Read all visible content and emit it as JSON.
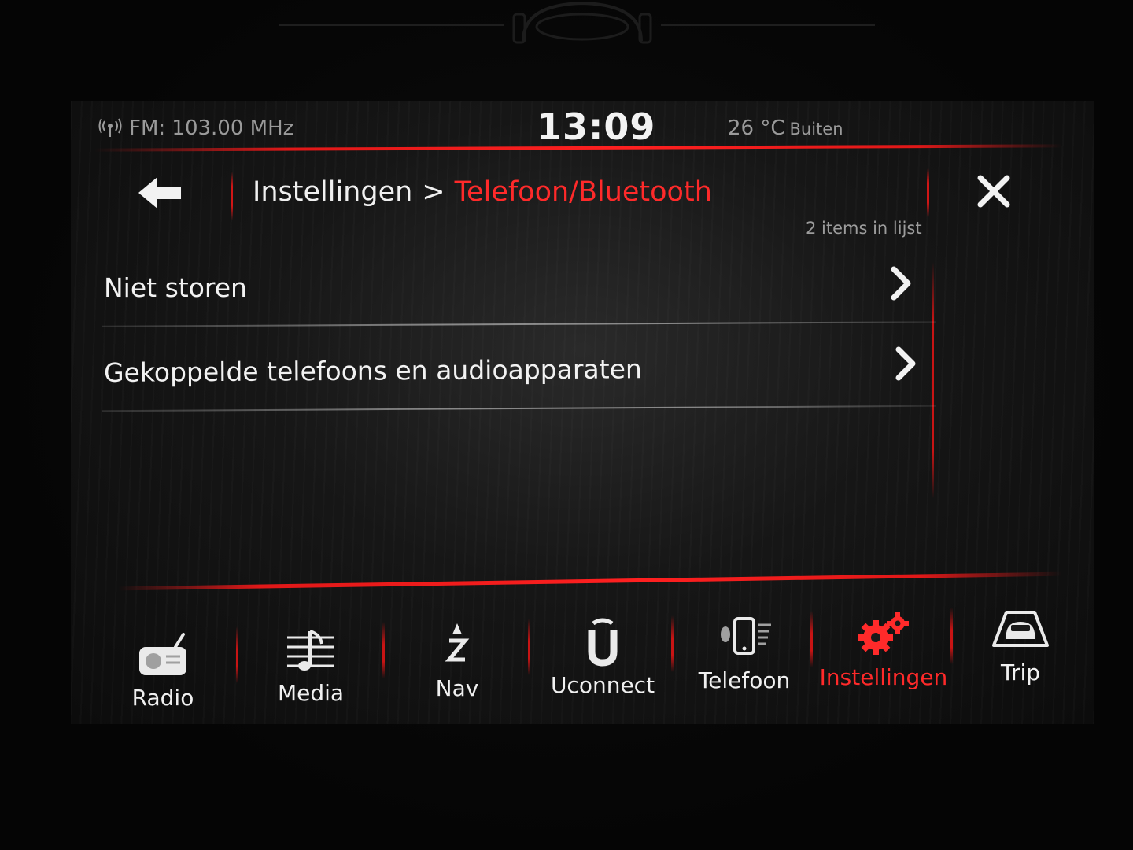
{
  "status": {
    "radio": "FM: 103.00 MHz",
    "clock": "13:09",
    "temperature": "26 °C",
    "temperature_label": "Buiten"
  },
  "header": {
    "breadcrumb_parent": "Instellingen",
    "breadcrumb_separator": ">",
    "breadcrumb_current": "Telefoon/Bluetooth",
    "items_count": "2 items in lijst"
  },
  "list": {
    "items": [
      {
        "label": "Niet storen"
      },
      {
        "label": "Gekoppelde telefoons en audioapparaten"
      }
    ]
  },
  "nav": {
    "items": [
      {
        "label": "Radio",
        "icon": "radio-icon"
      },
      {
        "label": "Media",
        "icon": "music-note-icon"
      },
      {
        "label": "Nav",
        "icon": "compass-icon"
      },
      {
        "label": "Uconnect",
        "icon": "uconnect-icon"
      },
      {
        "label": "Telefoon",
        "icon": "phone-bluetooth-icon"
      },
      {
        "label": "Instellingen",
        "icon": "gear-icon",
        "active": true
      },
      {
        "label": "Trip",
        "icon": "car-icon"
      }
    ]
  },
  "colors": {
    "accent_red": "#ff2a2a",
    "text_white": "#f0f0f0",
    "text_gray": "#9a9a9a"
  }
}
